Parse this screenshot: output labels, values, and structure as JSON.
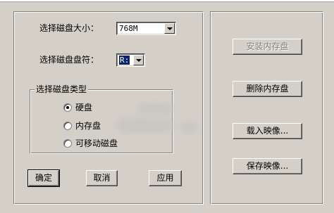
{
  "left": {
    "disk_size_label": "选择磁盘大小：",
    "disk_size_value": "768M",
    "drive_letter_label": "选择磁盘盘符：",
    "drive_letter_value": "R:",
    "disk_type_group": {
      "title": "选择磁盘类型",
      "options": [
        "硬盘",
        "内存盘",
        "可移动磁盘"
      ],
      "selected_index": 0
    },
    "buttons": {
      "ok": "确定",
      "cancel": "取消",
      "apply": "应用"
    }
  },
  "right": {
    "buttons": {
      "install": "安装内存盘",
      "remove": "删除内存盘",
      "load_image": "载入映像...",
      "save_image": "保存映像..."
    }
  }
}
